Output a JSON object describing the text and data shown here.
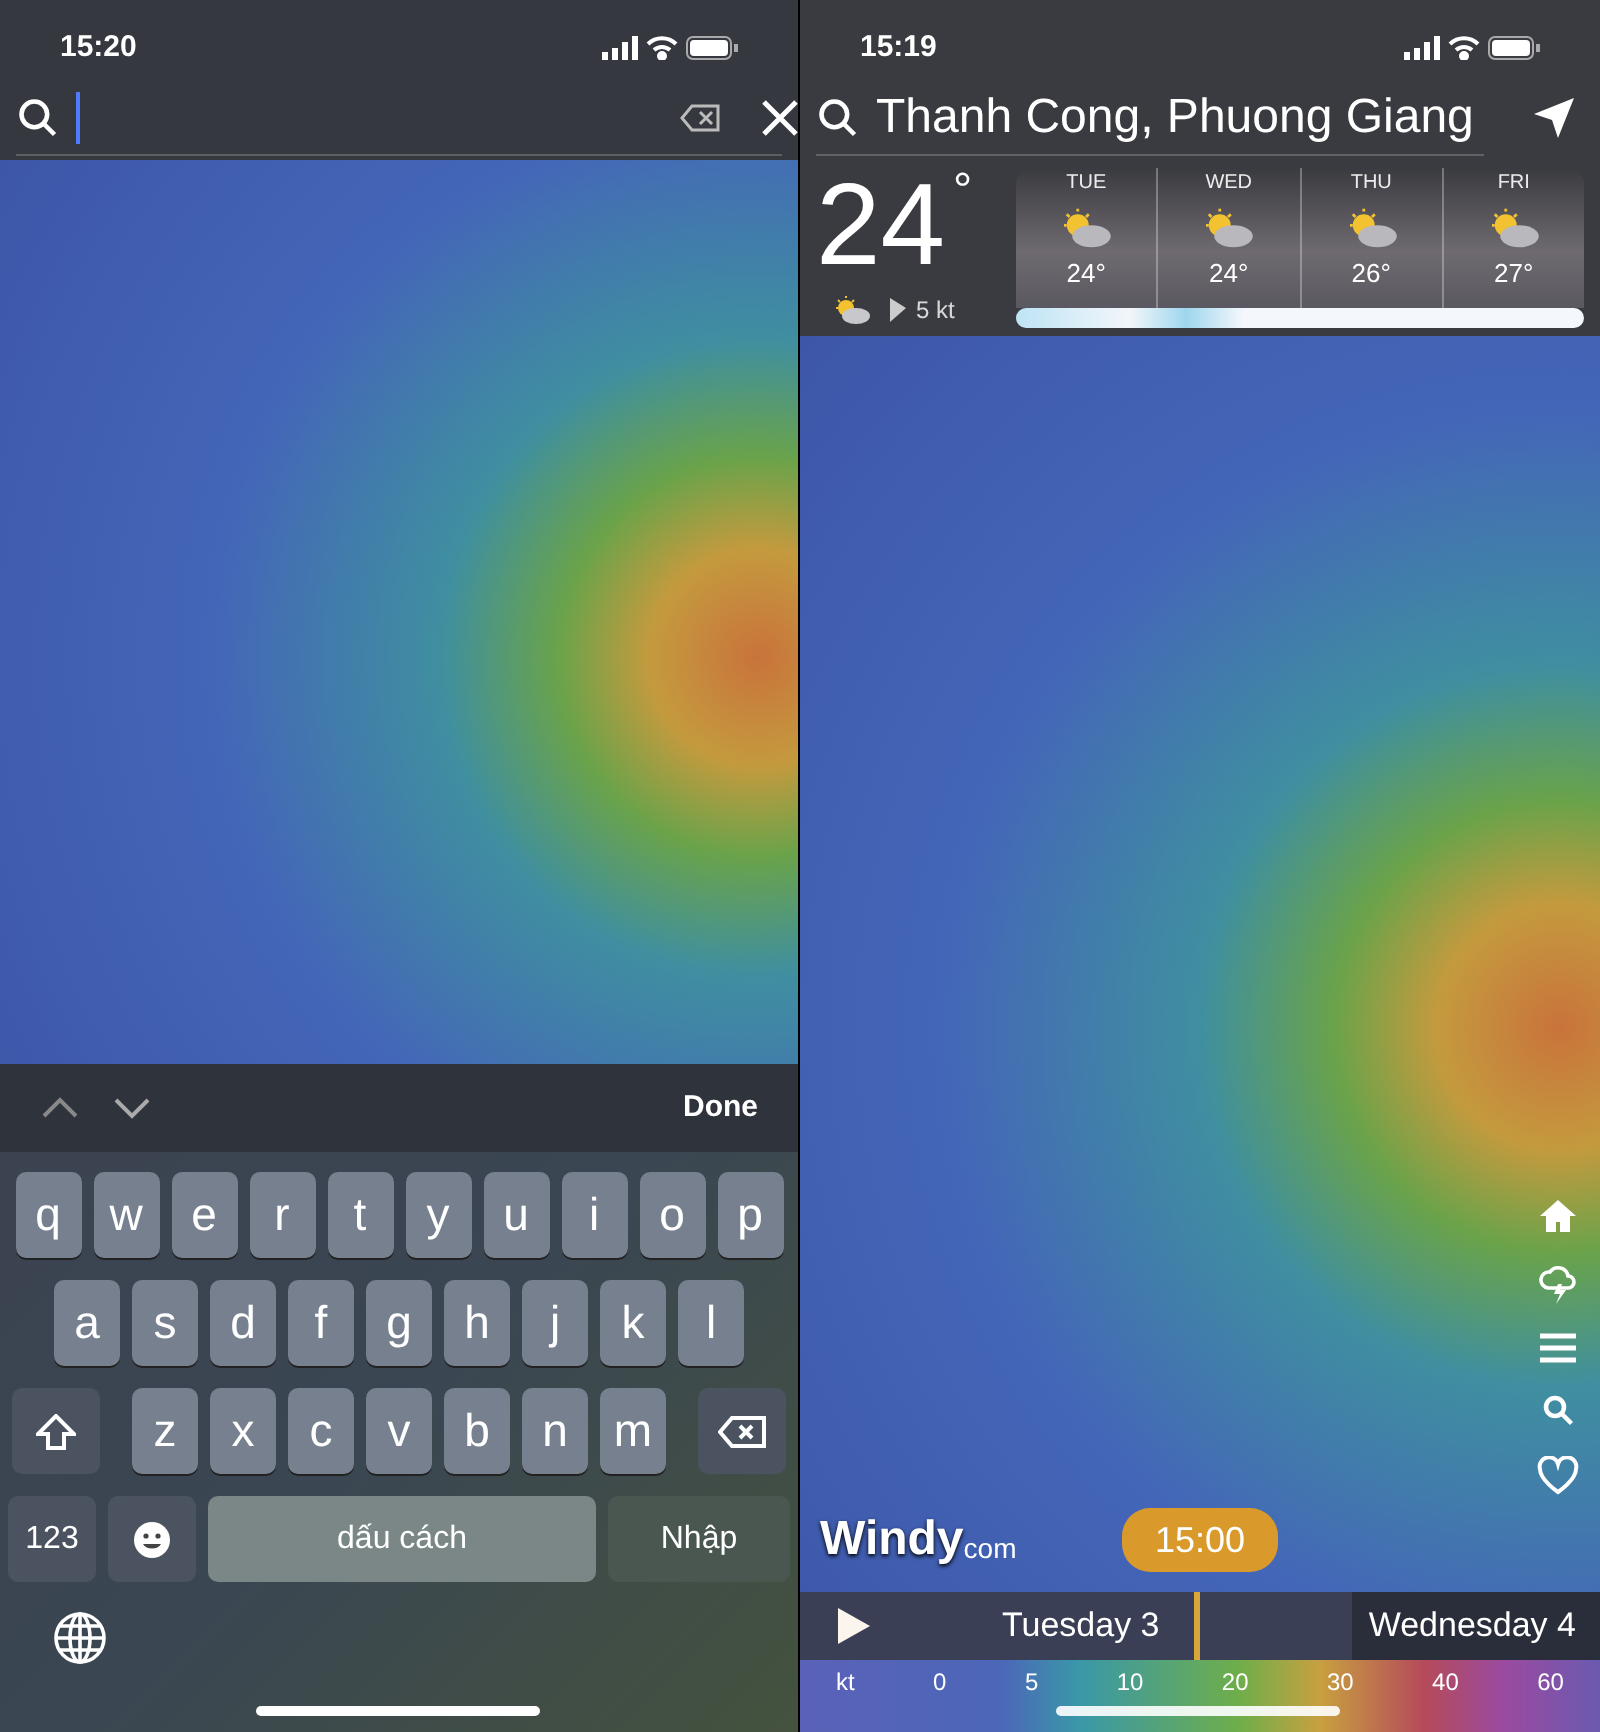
{
  "left_screen": {
    "status_bar": {
      "time": "15:20"
    },
    "keyboard": {
      "done": "Done",
      "rows": [
        [
          "q",
          "w",
          "e",
          "r",
          "t",
          "y",
          "u",
          "i",
          "o",
          "p"
        ],
        [
          "a",
          "s",
          "d",
          "f",
          "g",
          "h",
          "j",
          "k",
          "l"
        ],
        [
          "z",
          "x",
          "c",
          "v",
          "b",
          "n",
          "m"
        ]
      ],
      "numbers_key": "123",
      "space_key": "dấu cách",
      "return_key": "Nhập"
    }
  },
  "right_screen": {
    "status_bar": {
      "time": "15:19"
    },
    "search": {
      "value": "Thanh Cong, Phuong Giang"
    },
    "current": {
      "temperature": "24",
      "degree": "°",
      "wind": "5 kt"
    },
    "forecast": [
      {
        "day": "TUE",
        "temp": "24°"
      },
      {
        "day": "WED",
        "temp": "24°"
      },
      {
        "day": "THU",
        "temp": "26°"
      },
      {
        "day": "FRI",
        "temp": "27°"
      }
    ],
    "logo": {
      "name": "Windy",
      "suffix": "com"
    },
    "timeline": {
      "time": "15:00",
      "days": [
        "Tuesday 3",
        "Wednesday 4"
      ],
      "playing": false
    },
    "legend": {
      "unit": "kt",
      "stops": [
        "0",
        "5",
        "10",
        "20",
        "30",
        "40",
        "60"
      ]
    }
  }
}
